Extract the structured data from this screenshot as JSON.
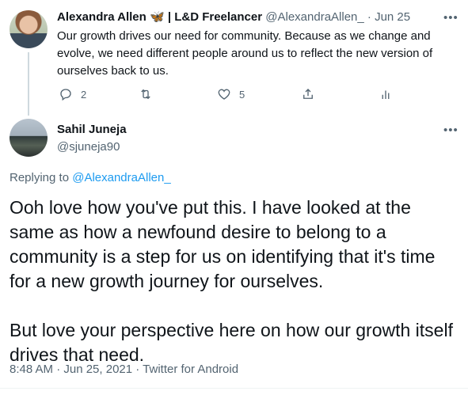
{
  "parent_tweet": {
    "author_name": "Alexandra Allen",
    "author_badge": "🦋 | L&D Freelancer",
    "handle": "@AlexandraAllen_",
    "separator": " · ",
    "date": "Jun 25",
    "text": "Our growth drives our need for community. Because as we change and\nevolve, we need different people around us to reflect the new version of\nourselves back to us.",
    "reply_count": "2",
    "retweet_count": "",
    "like_count": "5"
  },
  "reply_tweet": {
    "author_name": "Sahil Juneja",
    "handle": "@sjuneja90",
    "replying_prefix": "Replying to ",
    "replying_to": "@AlexandraAllen_",
    "text": "Ooh love how you've put this. I have looked at the\nsame as how a newfound desire to belong to a\ncommunity is a step for us on identifying that it's time\nfor a new growth journey for ourselves.\n\nBut love your perspective here on how our growth itself\ndrives that need.",
    "meta": "8:48 AM · Jun 25, 2021 · Twitter for Android"
  },
  "icons": {
    "more": "more-horizontal-icon",
    "reply": "reply-icon",
    "retweet": "retweet-icon",
    "like": "heart-icon",
    "share": "share-icon",
    "analytics": "analytics-icon"
  },
  "colors": {
    "link": "#1d9bf0",
    "muted": "#536471",
    "text": "#0f1419",
    "thread_line": "#cfd9de"
  }
}
